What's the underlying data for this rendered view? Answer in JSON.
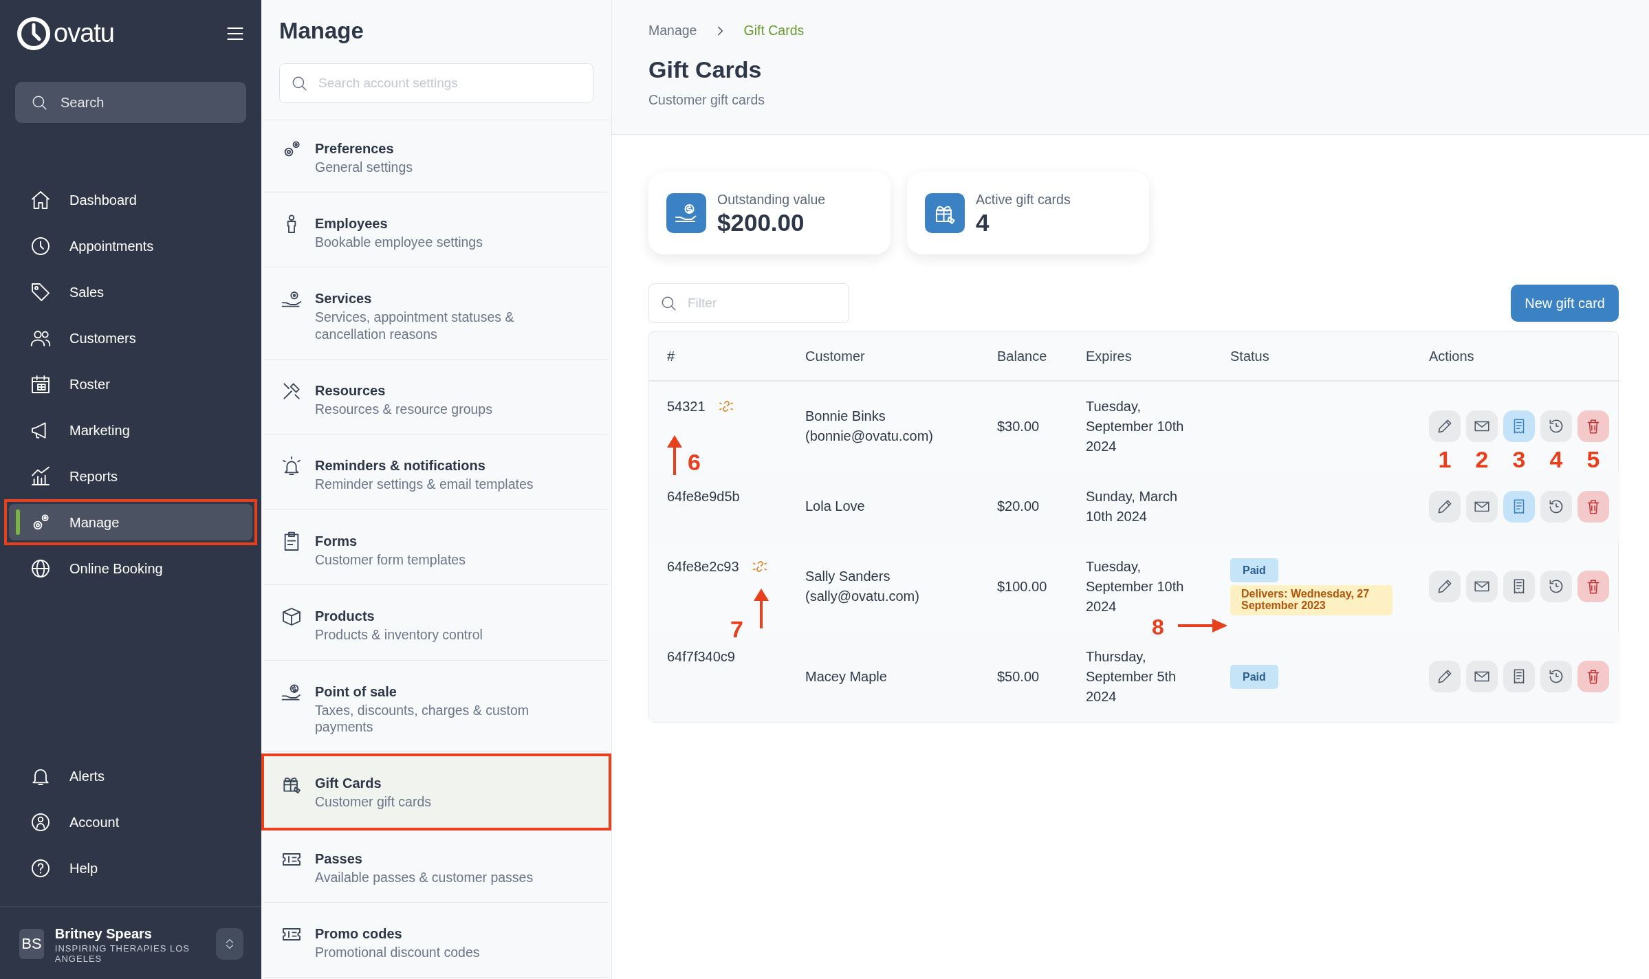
{
  "sidebar": {
    "logo": "ovatu",
    "search": {
      "placeholder": "Search"
    },
    "nav": [
      {
        "label": "Dashboard",
        "selected": false,
        "highlighted": false
      },
      {
        "label": "Appointments",
        "selected": false,
        "highlighted": false
      },
      {
        "label": "Sales",
        "selected": false,
        "highlighted": false
      },
      {
        "label": "Customers",
        "selected": false,
        "highlighted": false
      },
      {
        "label": "Roster",
        "selected": false,
        "highlighted": false
      },
      {
        "label": "Marketing",
        "selected": false,
        "highlighted": false
      },
      {
        "label": "Reports",
        "selected": false,
        "highlighted": false
      },
      {
        "label": "Manage",
        "selected": true,
        "highlighted": true
      },
      {
        "label": "Online Booking",
        "selected": false,
        "highlighted": false
      }
    ],
    "bottom_nav": [
      {
        "label": "Alerts"
      },
      {
        "label": "Account"
      },
      {
        "label": "Help"
      }
    ],
    "user": {
      "initials": "BS",
      "name": "Britney Spears",
      "org": "INSPIRING THERAPIES LOS ANGELES"
    }
  },
  "manage_panel": {
    "title": "Manage",
    "search": {
      "placeholder": "Search account settings"
    },
    "items": [
      {
        "title": "Preferences",
        "subtitle": "General settings",
        "selected": false,
        "highlighted": false
      },
      {
        "title": "Employees",
        "subtitle": "Bookable employee settings",
        "selected": false,
        "highlighted": false
      },
      {
        "title": "Services",
        "subtitle": "Services, appointment statuses & cancellation reasons",
        "selected": false,
        "highlighted": false
      },
      {
        "title": "Resources",
        "subtitle": "Resources & resource groups",
        "selected": false,
        "highlighted": false
      },
      {
        "title": "Reminders & notifications",
        "subtitle": "Reminder settings & email templates",
        "selected": false,
        "highlighted": false
      },
      {
        "title": "Forms",
        "subtitle": "Customer form templates",
        "selected": false,
        "highlighted": false
      },
      {
        "title": "Products",
        "subtitle": "Products & inventory control",
        "selected": false,
        "highlighted": false
      },
      {
        "title": "Point of sale",
        "subtitle": "Taxes, discounts, charges & custom payments",
        "selected": false,
        "highlighted": false
      },
      {
        "title": "Gift Cards",
        "subtitle": "Customer gift cards",
        "selected": true,
        "highlighted": true
      },
      {
        "title": "Passes",
        "subtitle": "Available passes & customer passes",
        "selected": false,
        "highlighted": false
      },
      {
        "title": "Promo codes",
        "subtitle": "Promotional discount codes",
        "selected": false,
        "highlighted": false
      }
    ]
  },
  "breadcrumb": [
    {
      "label": "Manage",
      "selected": false
    },
    {
      "label": "Gift Cards",
      "selected": true
    }
  ],
  "page": {
    "title": "Gift Cards",
    "subtitle": "Customer gift cards"
  },
  "stats": [
    {
      "label": "Outstanding value",
      "value": "$200.00"
    },
    {
      "label": "Active gift cards",
      "value": "4"
    }
  ],
  "filter": {
    "placeholder": "Filter"
  },
  "new_button": "New gift card",
  "table": {
    "columns": [
      "#",
      "Customer",
      "Balance",
      "Expires",
      "Status",
      "Actions"
    ],
    "rows": [
      {
        "number": "54321",
        "linked": true,
        "customer_name": "Bonnie Binks",
        "customer_email": "(bonnie@ovatu.com)",
        "balance": "$30.00",
        "expires": "Tuesday, September 10th 2024",
        "badges": [],
        "receipt_active": true,
        "id_callout": {
          "label": "6",
          "kind": "label-right"
        },
        "action_callouts": [
          "1",
          "2",
          "3",
          "4",
          "5"
        ]
      },
      {
        "number": "64fe8e9d5b",
        "linked": false,
        "customer_name": "Lola Love",
        "balance": "$20.00",
        "expires": "Sunday, March 10th 2024",
        "badges": [],
        "receipt_active": true
      },
      {
        "number": "64fe8e2c93",
        "linked": true,
        "customer_name": "Sally Sanders",
        "customer_email": "(sally@ovatu.com)",
        "balance": "$100.00",
        "expires": "Tuesday, September 10th 2024",
        "badges": [
          {
            "kind": "paid",
            "text": "Paid"
          },
          {
            "kind": "delivery",
            "text": "Delivers: Wednesday, 27 September 2023"
          }
        ],
        "receipt_active": false,
        "id_callout": {
          "label": "7",
          "kind": "label-left"
        },
        "status_callout": "8"
      },
      {
        "number": "64f7f340c9",
        "linked": false,
        "customer_name": "Macey Maple",
        "balance": "$50.00",
        "expires": "Thursday, September 5th 2024",
        "badges": [
          {
            "kind": "paid",
            "text": "Paid"
          }
        ],
        "receipt_active": false
      }
    ]
  }
}
